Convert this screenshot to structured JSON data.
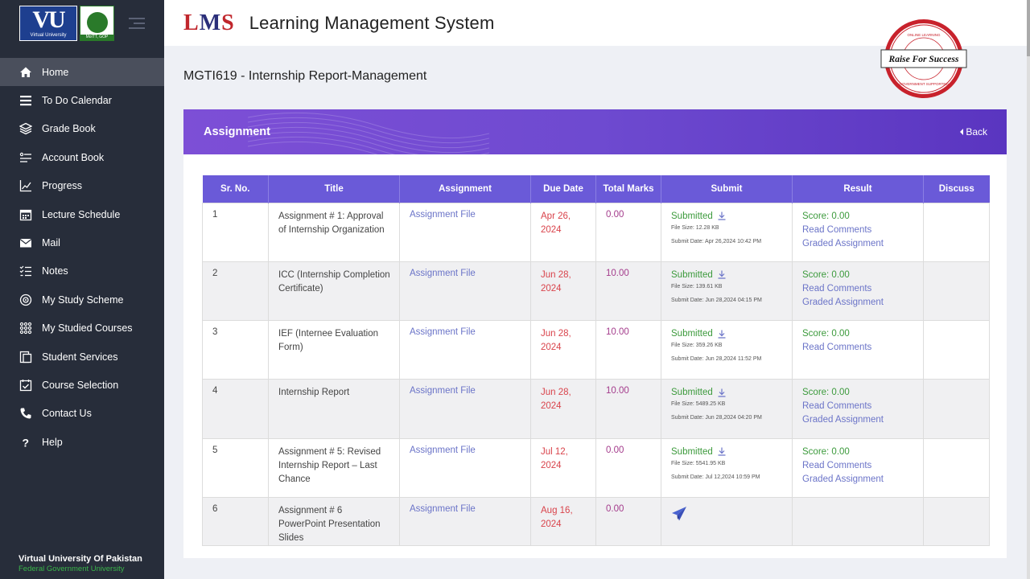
{
  "sidebar": {
    "logo_vu_big": "VU",
    "logo_vu_small": "Virtual University",
    "logo_gop": "MoITT, GOP",
    "items": [
      {
        "label": "Home",
        "icon": "home-icon"
      },
      {
        "label": "To Do Calendar",
        "icon": "calendar-list-icon"
      },
      {
        "label": "Grade Book",
        "icon": "layers-icon"
      },
      {
        "label": "Account Book",
        "icon": "account-book-icon"
      },
      {
        "label": "Progress",
        "icon": "chart-icon"
      },
      {
        "label": "Lecture Schedule",
        "icon": "schedule-icon"
      },
      {
        "label": "Mail",
        "icon": "mail-icon"
      },
      {
        "label": "Notes",
        "icon": "notes-icon"
      },
      {
        "label": "My Study Scheme",
        "icon": "scheme-icon"
      },
      {
        "label": "My Studied Courses",
        "icon": "grid-icon"
      },
      {
        "label": "Student Services",
        "icon": "services-icon"
      },
      {
        "label": "Course Selection",
        "icon": "course-selection-icon"
      },
      {
        "label": "Contact Us",
        "icon": "phone-icon"
      },
      {
        "label": "Help",
        "icon": "help-icon"
      }
    ],
    "footer_line1": "Virtual University Of Pakistan",
    "footer_line2": "Federal Government University"
  },
  "header": {
    "logo_l": "L",
    "logo_m": "M",
    "logo_s": "S",
    "title": "Learning Management System"
  },
  "badge": {
    "top_text": "ONLINE LEARNING",
    "main_text": "Raise For Success",
    "bottom_text": "GOVERNMENT SUPPORTED"
  },
  "page_title": "MGTI619 - Internship Report-Management",
  "card": {
    "title": "Assignment",
    "back_label": "Back"
  },
  "table": {
    "headers": [
      "Sr. No.",
      "Title",
      "Assignment",
      "Due Date",
      "Total Marks",
      "Submit",
      "Result",
      "Discuss"
    ],
    "rows": [
      {
        "sr": "1",
        "title": "Assignment # 1: Approval of Internship Organization",
        "assignment": "Assignment File",
        "due_line1": "Apr 26,",
        "due_line2": "2024",
        "marks": "0.00",
        "status": "Submitted",
        "file_size": "File Size: 12.28 KB",
        "submit_date": "Submit Date: Apr 26,2024 10:42 PM",
        "score": "Score: 0.00",
        "read_comments": "Read Comments",
        "graded": "Graded Assignment",
        "discuss": ""
      },
      {
        "sr": "2",
        "title": "ICC (Internship Completion Certificate)",
        "assignment": "Assignment File",
        "due_line1": "Jun 28,",
        "due_line2": "2024",
        "marks": "10.00",
        "status": "Submitted",
        "file_size": "File Size: 139.61 KB",
        "submit_date": "Submit Date: Jun 28,2024 04:15 PM",
        "score": "Score: 0.00",
        "read_comments": "Read Comments",
        "graded": "Graded Assignment",
        "discuss": ""
      },
      {
        "sr": "3",
        "title": "IEF (Internee Evaluation Form)",
        "assignment": "Assignment File",
        "due_line1": "Jun 28,",
        "due_line2": "2024",
        "marks": "10.00",
        "status": "Submitted",
        "file_size": "File Size: 359.26 KB",
        "submit_date": "Submit Date: Jun 28,2024 11:52 PM",
        "score": "Score: 0.00",
        "read_comments": "Read Comments",
        "graded": "",
        "discuss": ""
      },
      {
        "sr": "4",
        "title": "Internship Report",
        "assignment": "Assignment File",
        "due_line1": "Jun 28,",
        "due_line2": "2024",
        "marks": "10.00",
        "status": "Submitted",
        "file_size": "File Size: 5489.25 KB",
        "submit_date": "Submit Date: Jun 28,2024 04:20 PM",
        "score": "Score: 0.00",
        "read_comments": "Read Comments",
        "graded": "Graded Assignment",
        "discuss": ""
      },
      {
        "sr": "5",
        "title": "Assignment # 5: Revised Internship Report – Last Chance",
        "assignment": "Assignment File",
        "due_line1": "Jul 12,",
        "due_line2": "2024",
        "marks": "0.00",
        "status": "Submitted",
        "file_size": "File Size: 5541.95 KB",
        "submit_date": "Submit Date: Jul 12,2024 10:59 PM",
        "score": "Score: 0.00",
        "read_comments": "Read Comments",
        "graded": "Graded Assignment",
        "discuss": ""
      },
      {
        "sr": "6",
        "title": "Assignment # 6 PowerPoint Presentation Slides",
        "assignment": "Assignment File",
        "due_line1": "Aug 16,",
        "due_line2": "2024",
        "marks": "0.00",
        "status": "",
        "file_size": "",
        "submit_date": "",
        "score": "",
        "read_comments": "",
        "graded": "",
        "discuss": ""
      }
    ]
  },
  "colors": {
    "sidebar_bg": "#272d3a",
    "header_gradient": "#7d4fd6",
    "table_header": "#6a5ad8",
    "submitted_green": "#3c9a3c",
    "due_red": "#d9434b",
    "link_blue": "#6b74c8"
  }
}
